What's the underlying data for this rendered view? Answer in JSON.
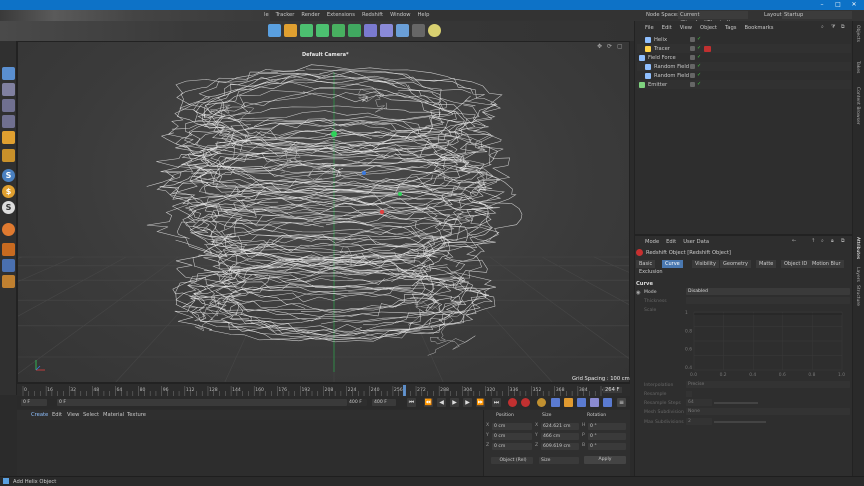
{
  "menubar": {
    "items": [
      "le",
      "Tracker",
      "Render",
      "Extensions",
      "Redshift",
      "Window",
      "Help"
    ]
  },
  "header_right": {
    "node_space_label": "Node Space:",
    "node_space_value": "Current (Standard/Physical)",
    "layout_label": "Layout:",
    "layout_value": "Startup"
  },
  "objmgr": {
    "menu": [
      "File",
      "Edit",
      "View",
      "Object",
      "Tags",
      "Bookmarks"
    ],
    "objects": [
      {
        "name": "Helix",
        "color": "#8fbfff",
        "indent": 1
      },
      {
        "name": "Tracer",
        "color": "#ffd24a",
        "indent": 1
      },
      {
        "name": "Field Force",
        "color": "#8fbfff",
        "indent": 0
      },
      {
        "name": "Random Field",
        "color": "#8fbfff",
        "indent": 1
      },
      {
        "name": "Random Field",
        "color": "#8fbfff",
        "indent": 1
      },
      {
        "name": "Emitter",
        "color": "#7fd37f",
        "indent": 0
      }
    ]
  },
  "viewport": {
    "camera": "Default Camera",
    "camera_suffix": "*",
    "grid_spacing": "Grid Spacing : 100 cm"
  },
  "timeline": {
    "ticks": [
      "0",
      "16",
      "32",
      "48",
      "64",
      "80",
      "96",
      "112",
      "128",
      "144",
      "160",
      "176",
      "192",
      "208",
      "224",
      "240",
      "256",
      "272",
      "288",
      "304",
      "320",
      "336",
      "352",
      "368",
      "384",
      "400"
    ],
    "current_marker": "264 F",
    "start": "0 F",
    "min": "0 F",
    "max": "400 F",
    "end": "400 F"
  },
  "material": {
    "menu": [
      "Create",
      "Edit",
      "View",
      "Select",
      "Material",
      "Texture"
    ]
  },
  "coords": {
    "headers": [
      "Position",
      "Size",
      "Rotation"
    ],
    "rows": [
      {
        "axis": "X",
        "pos": "0 cm",
        "size_axis": "X",
        "size": "624.621 cm",
        "rot_axis": "H",
        "rot": "0 °"
      },
      {
        "axis": "Y",
        "pos": "0 cm",
        "size_axis": "Y",
        "size": "466 cm",
        "rot_axis": "P",
        "rot": "0 °"
      },
      {
        "axis": "Z",
        "pos": "0 cm",
        "size_axis": "Z",
        "size": "609.619 cm",
        "rot_axis": "B",
        "rot": "0 °"
      }
    ],
    "mode_select": "Object (Rel)",
    "size_select": "Size",
    "apply": "Apply"
  },
  "attr": {
    "menu": [
      "Mode",
      "Edit",
      "User Data"
    ],
    "object_title": "Redshift Object [Redshift Object]",
    "tabs": [
      "Basic",
      "Curve",
      "Visibility",
      "Geometry",
      "Matte",
      "Object ID",
      "Motion Blur"
    ],
    "active_tab": "Curve",
    "tab_row2": "Exclusion",
    "section": "Curve",
    "mode_label": "Mode",
    "mode_value": "Disabled",
    "thickness_label": "Thickness",
    "scale_label": "Scale",
    "graph_y": [
      "1",
      "0.8",
      "0.6",
      "0.4"
    ],
    "graph_x": [
      "0.0",
      "0.2",
      "0.4",
      "0.6",
      "0.8",
      "1.0"
    ],
    "interpolation_label": "Interpolation",
    "interpolation_value": "Precise",
    "resample_label": "Resample",
    "resample_steps_label": "Resample Steps",
    "resample_steps_value": "64",
    "mesh_sub_label": "Mesh Subdivision",
    "mesh_sub_value": "None",
    "max_sub_label": "Max Subdivisions",
    "max_sub_value": "2"
  },
  "right_tabs": [
    "Objects",
    "Takes",
    "Content Browser",
    "Attributes",
    "Layers",
    "Structure"
  ],
  "status": "Add Helix Object"
}
